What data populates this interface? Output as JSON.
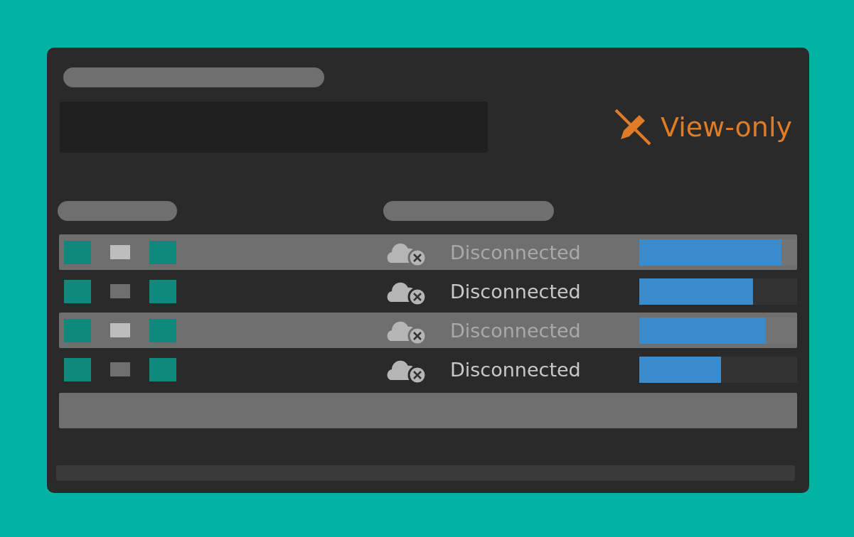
{
  "badge": {
    "text": "View-only"
  },
  "rows": [
    {
      "selected": true,
      "status": "Disconnected",
      "level": 0.9
    },
    {
      "selected": false,
      "status": "Disconnected",
      "level": 0.72
    },
    {
      "selected": true,
      "status": "Disconnected",
      "level": 0.8
    },
    {
      "selected": false,
      "status": "Disconnected",
      "level": 0.52
    }
  ]
}
